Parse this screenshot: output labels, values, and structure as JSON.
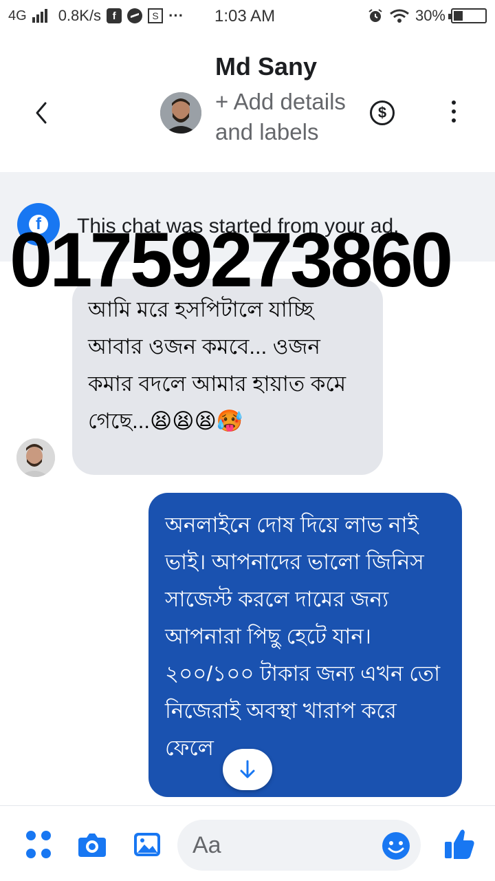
{
  "status_bar": {
    "network": "4G",
    "speed": "0.8K/s",
    "time": "1:03 AM",
    "battery": "30%",
    "battery_level": 0.3
  },
  "header": {
    "contact_name": "Md Sany",
    "subtitle": "+ Add details and labels"
  },
  "ad_banner": {
    "text": "This chat was started from your ad."
  },
  "overlay": {
    "phone_number": "01759273860"
  },
  "messages": [
    {
      "direction": "incoming",
      "text": "আমি মরে হসপিটালে যাচ্ছি আবার ওজন কমবে... ওজন কমার বদলে আমার হায়াত কমে গেছে...😫😫😫🥵"
    },
    {
      "direction": "outgoing",
      "text": "অনলাইনে দোষ দিয়ে লাভ নাই ভাই। আপনাদের ভালো জিনিস সাজেস্ট করলে দামের জন্য আপনারা পিছু হেটে যান। ২০০/১০০ টাকার জন্য এখন তো নিজেরাই অবস্থা খারাপ করে ফেলে"
    }
  ],
  "composer": {
    "placeholder": "Aa"
  },
  "colors": {
    "accent": "#1877f2",
    "outgoing_bubble": "#1a52b0",
    "incoming_bubble": "#e4e6eb",
    "banner_bg": "#f0f2f5"
  }
}
